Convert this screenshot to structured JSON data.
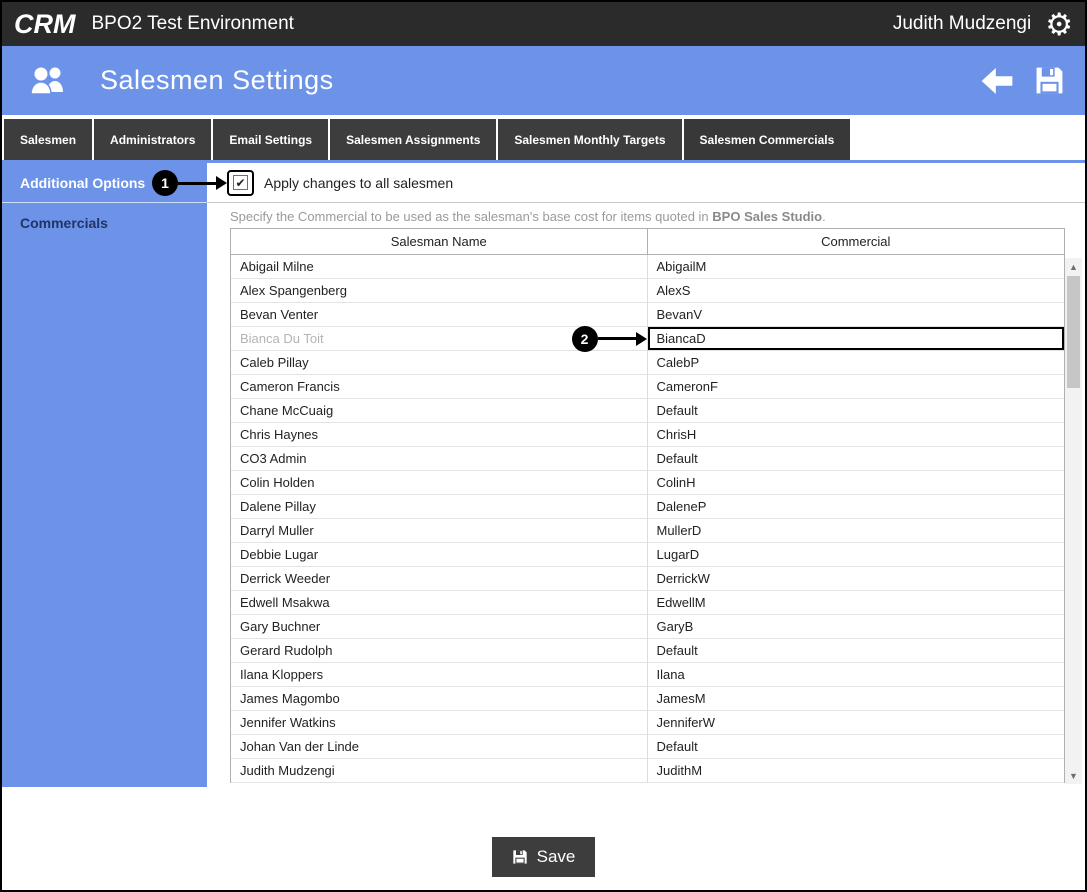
{
  "colors": {
    "accent": "#6d93e9",
    "titlebar": "#2b2b2b",
    "tab": "#3d3d3d"
  },
  "titlebar": {
    "logo": "CRM",
    "title": "BPO2 Test Environment",
    "user": "Judith Mudzengi"
  },
  "header": {
    "title": "Salesmen Settings"
  },
  "icons": {
    "gear": "⚙",
    "scroll_up": "▲",
    "scroll_down": "▼",
    "check": "✔"
  },
  "tabs": [
    {
      "label": "Salesmen",
      "active": false
    },
    {
      "label": "Administrators",
      "active": false
    },
    {
      "label": "Email Settings",
      "active": false
    },
    {
      "label": "Salesmen Assignments",
      "active": false
    },
    {
      "label": "Salesmen Monthly Targets",
      "active": false
    },
    {
      "label": "Salesmen Commercials",
      "active": true
    }
  ],
  "sidebar": {
    "items": [
      {
        "label": "Additional Options",
        "active": true
      },
      {
        "label": "Commercials",
        "active": false
      }
    ]
  },
  "options": {
    "apply_all_label": "Apply changes to all salesmen",
    "checked": true
  },
  "description": {
    "prefix": "Specify the Commercial to be used as the salesman's base cost for items quoted in ",
    "bold": "BPO Sales Studio",
    "suffix": "."
  },
  "annotations": {
    "step1": "1",
    "step2": "2"
  },
  "table": {
    "columns": [
      "Salesman Name",
      "Commercial"
    ],
    "rows": [
      {
        "name": "Abigail Milne",
        "commercial": "AbigailM"
      },
      {
        "name": "Alex Spangenberg",
        "commercial": "AlexS"
      },
      {
        "name": "Bevan Venter",
        "commercial": "BevanV"
      },
      {
        "name": "Bianca Du Toit",
        "commercial": "BiancaD",
        "muted": true,
        "highlighted": true,
        "annotation": "2"
      },
      {
        "name": "Caleb Pillay",
        "commercial": "CalebP"
      },
      {
        "name": "Cameron Francis",
        "commercial": "CameronF"
      },
      {
        "name": "Chane McCuaig",
        "commercial": "Default"
      },
      {
        "name": "Chris Haynes",
        "commercial": "ChrisH"
      },
      {
        "name": "CO3 Admin",
        "commercial": "Default"
      },
      {
        "name": "Colin Holden",
        "commercial": "ColinH"
      },
      {
        "name": "Dalene Pillay",
        "commercial": "DaleneP"
      },
      {
        "name": "Darryl Muller",
        "commercial": "MullerD"
      },
      {
        "name": "Debbie Lugar",
        "commercial": "LugarD"
      },
      {
        "name": "Derrick Weeder",
        "commercial": "DerrickW"
      },
      {
        "name": "Edwell Msakwa",
        "commercial": "EdwellM"
      },
      {
        "name": "Gary Buchner",
        "commercial": "GaryB"
      },
      {
        "name": "Gerard Rudolph",
        "commercial": "Default"
      },
      {
        "name": "Ilana Kloppers",
        "commercial": "Ilana"
      },
      {
        "name": "James Magombo",
        "commercial": "JamesM"
      },
      {
        "name": "Jennifer Watkins",
        "commercial": "JenniferW"
      },
      {
        "name": "Johan Van der Linde",
        "commercial": "Default"
      },
      {
        "name": "Judith Mudzengi",
        "commercial": "JudithM"
      }
    ]
  },
  "footer": {
    "save_label": "Save"
  }
}
